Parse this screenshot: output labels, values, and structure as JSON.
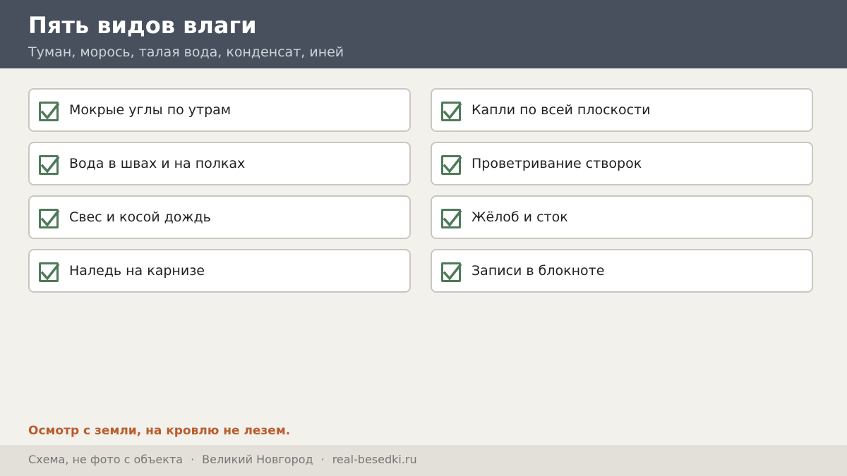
{
  "header": {
    "title": "Пять видов влаги",
    "subtitle": "Туман, морось, талая вода, конденсат, иней"
  },
  "checklist": {
    "items": [
      {
        "label": "Мокрые углы по утрам",
        "checked": true
      },
      {
        "label": "Капли по всей плоскости",
        "checked": true
      },
      {
        "label": "Вода в швах и на полках",
        "checked": true
      },
      {
        "label": "Проветривание створок",
        "checked": true
      },
      {
        "label": "Свес и косой дождь",
        "checked": true
      },
      {
        "label": "Жёлоб и сток",
        "checked": true
      },
      {
        "label": "Наледь на карнизе",
        "checked": true
      },
      {
        "label": "Записи в блокноте",
        "checked": true
      }
    ]
  },
  "note": "Осмотр с земли, на кровлю не лезем.",
  "footer": {
    "parts": [
      "Схема, не фото с объекта",
      "Великий Новгород",
      "real-besedki.ru"
    ],
    "separator": "·"
  },
  "colors": {
    "header_bg": "#47505c",
    "page_bg": "#f3f1ec",
    "check": "#4f7a59",
    "accent": "#b85d2e",
    "footer_bg": "#e3e0d9"
  },
  "icons": {
    "checkbox": "checkbox-checked-icon"
  }
}
